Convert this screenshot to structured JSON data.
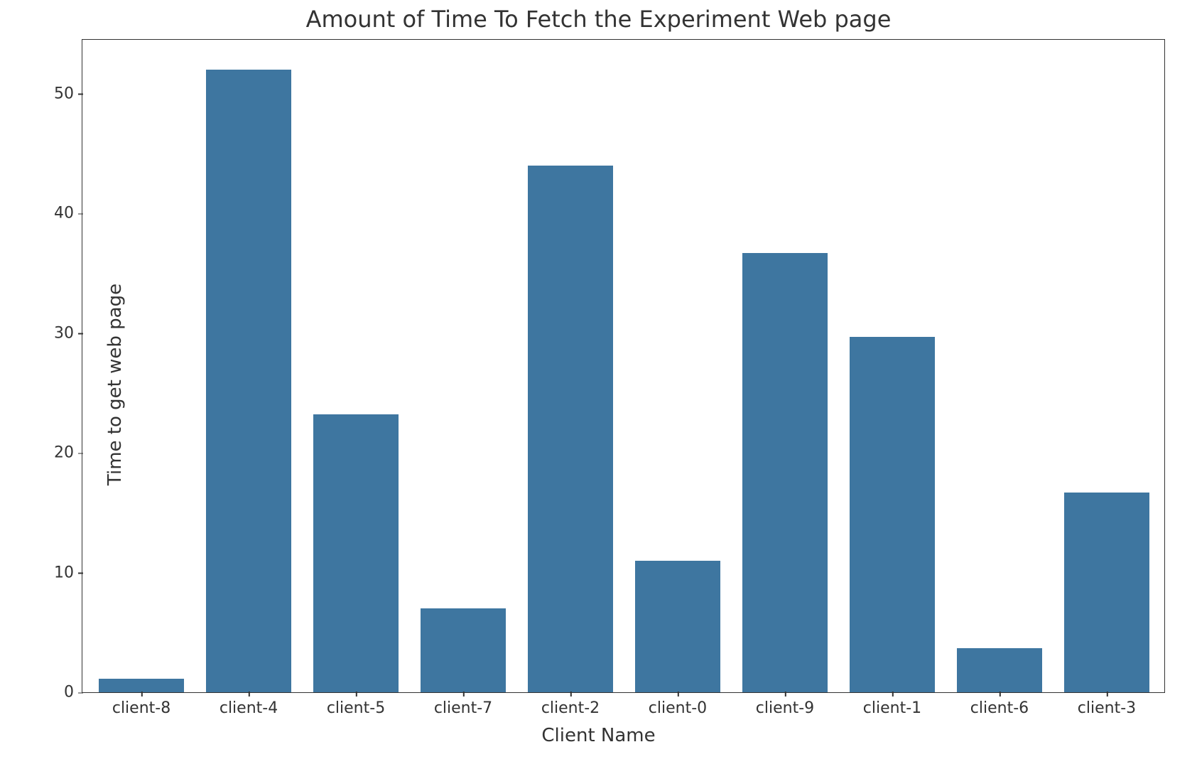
{
  "chart_data": {
    "type": "bar",
    "title": "Amount of Time To Fetch the Experiment Web page",
    "xlabel": "Client Name",
    "ylabel": "Time to get web page",
    "categories": [
      "client-8",
      "client-4",
      "client-5",
      "client-7",
      "client-2",
      "client-0",
      "client-9",
      "client-1",
      "client-6",
      "client-3"
    ],
    "values": [
      1.1,
      52,
      23.2,
      7,
      44,
      11,
      36.7,
      29.7,
      3.7,
      16.7
    ],
    "ylim": [
      0,
      54.6
    ],
    "yticks": [
      0,
      10,
      20,
      30,
      40,
      50
    ],
    "bar_color": "#3e76a0"
  }
}
